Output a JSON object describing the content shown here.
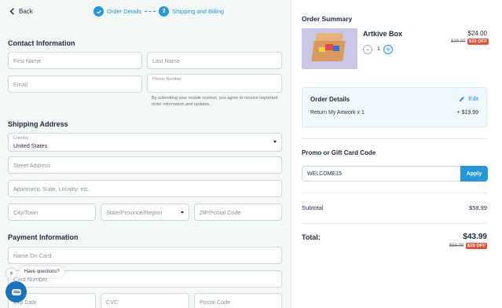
{
  "nav": {
    "back_label": "Back"
  },
  "steps": [
    {
      "label": "Order Details",
      "state": "done"
    },
    {
      "number": "2",
      "label": "Shipping and Billing",
      "state": "current"
    }
  ],
  "contact": {
    "title": "Contact Information",
    "first_name_placeholder": "First Name",
    "last_name_placeholder": "Last Name",
    "email_placeholder": "Email",
    "phone_label": "Phone Number",
    "phone_note": "By submitting your mobile number, you agree to receive important order information and updates."
  },
  "shipping": {
    "title": "Shipping Address",
    "country_label": "Country",
    "country_value": "United States",
    "street_placeholder": "Street Address",
    "apartment_placeholder": "Apartment, Suite, Locality, etc.",
    "city_placeholder": "City/Town",
    "state_placeholder": "State/Province/Region",
    "zip_placeholder": "ZIP/Postal Code"
  },
  "payment": {
    "title": "Payment Information",
    "name_on_card_placeholder": "Name On Card",
    "card_number_placeholder": "Card Number",
    "exp_placeholder": "Exp Date",
    "cvc_placeholder": "CVC",
    "postal_placeholder": "Postal Code"
  },
  "chat": {
    "bubble_text": "Have questions?",
    "close_glyph": "×"
  },
  "summary": {
    "title": "Order Summary",
    "product": {
      "name": "Artkive Box",
      "price": "$24.00",
      "old_price": "$39.00",
      "discount_badge": "$15 OFF",
      "quantity": "1",
      "minus_glyph": "−",
      "plus_glyph": "+"
    },
    "order_details": {
      "title": "Order Details",
      "edit_label": "Edit",
      "line_label": "Return My Artwork x 1",
      "line_price": "+ $19.99"
    },
    "promo": {
      "title": "Promo or Gift Card Code",
      "code_value": "WELCOME15",
      "apply_label": "Apply"
    },
    "subtotal": {
      "label": "Subtotal",
      "value": "$58.99"
    },
    "total": {
      "label": "Total:",
      "value": "$43.99",
      "old_value": "$58.99",
      "discount_badge": "$15 OFF"
    }
  },
  "colors": {
    "accent": "#2596d8",
    "badge": "#e0523a",
    "text": "#1f2a44",
    "left_bg": "#f3f7f6"
  }
}
